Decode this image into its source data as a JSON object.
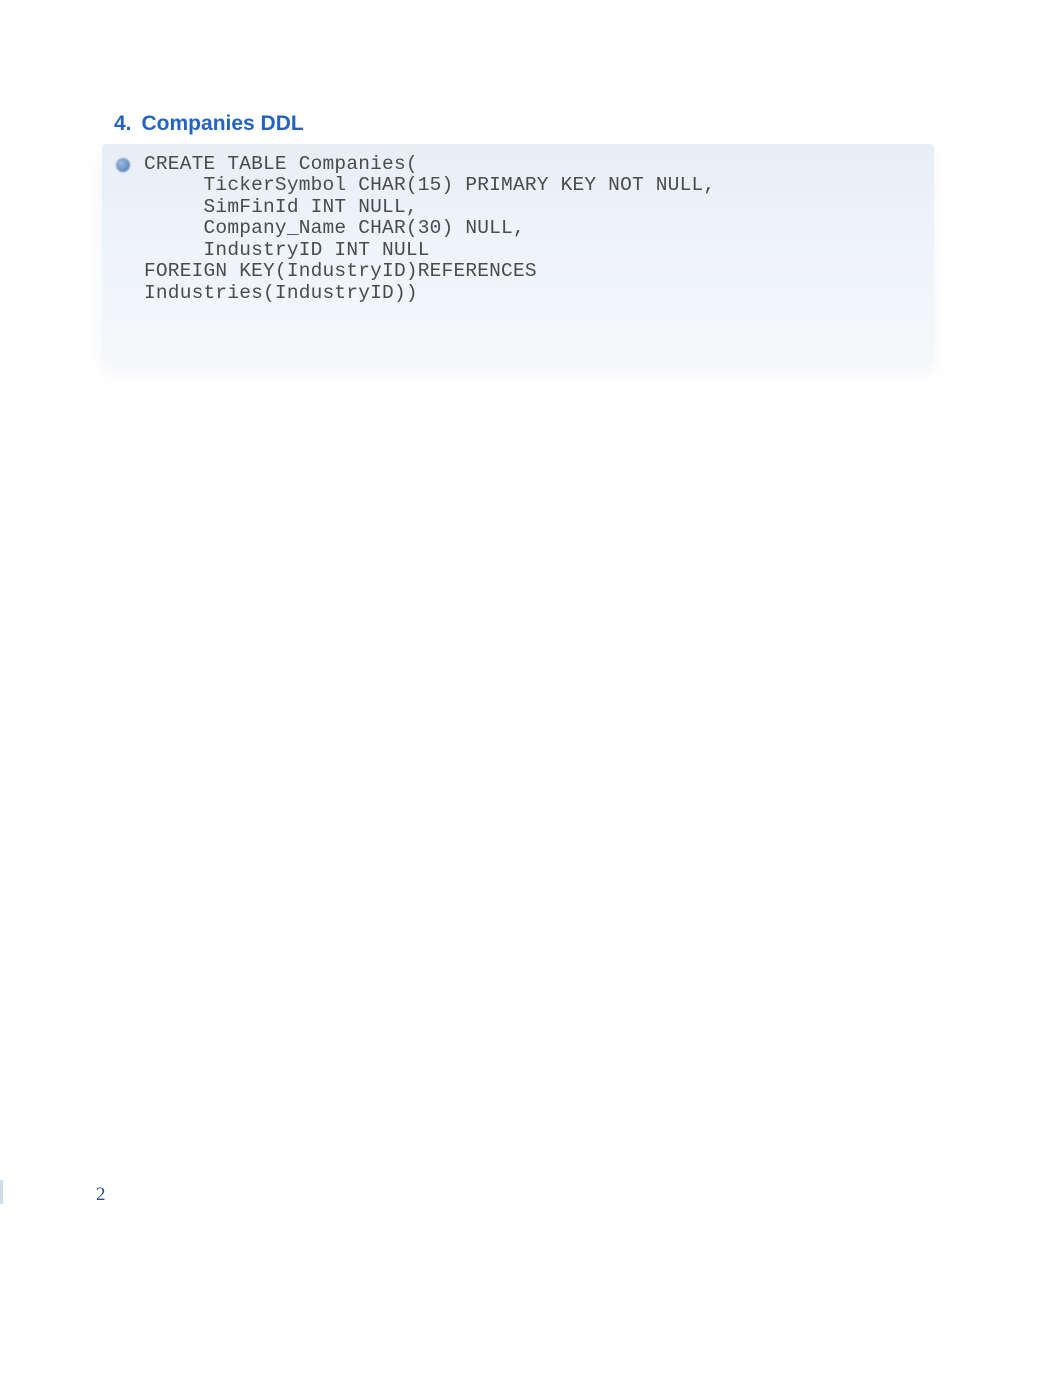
{
  "section": {
    "number": "4.",
    "title": "Companies DDL"
  },
  "code": "CREATE TABLE Companies(\n     TickerSymbol CHAR(15) PRIMARY KEY NOT NULL,\n     SimFinId INT NULL,\n     Company_Name CHAR(30) NULL,\n     IndustryID INT NULL\nFOREIGN KEY(IndustryID)REFERENCES\nIndustries(IndustryID))",
  "page_number": "2"
}
